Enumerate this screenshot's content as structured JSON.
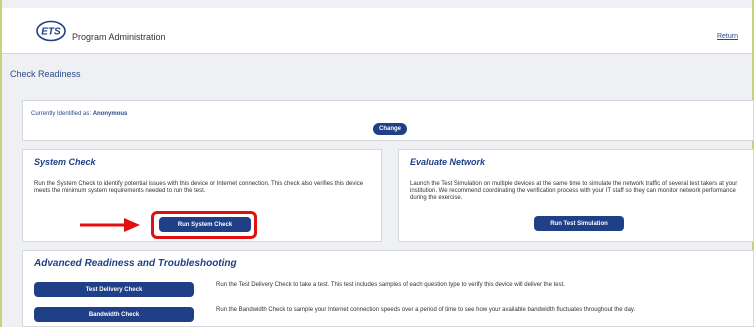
{
  "header": {
    "logo_text": "ETS",
    "title": "Program Administration",
    "return_label": "Return"
  },
  "page": {
    "title": "Check Readiness"
  },
  "identified": {
    "label": "Currently Identified as:",
    "value": "Anonymous",
    "change_label": "Change"
  },
  "system_check": {
    "heading": "System Check",
    "description": "Run the System Check to identify potential issues with this device or Internet connection. This check also verifies this device meets the minimum system requirements needed to run the test.",
    "button_label": "Run System Check"
  },
  "evaluate_network": {
    "heading": "Evaluate Network",
    "description": "Launch the Test Simulation on multiple devices at the same time to simulate the network traffic of several test takers at your institution. We recommend coordinating the verification process with your IT staff so they can monitor network performance during the exercise.",
    "button_label": "Run Test Simulation"
  },
  "advanced": {
    "heading": "Advanced Readiness and Troubleshooting",
    "items": [
      {
        "button_label": "Test Delivery Check",
        "description": "Run the Test Delivery Check to take a test. This test includes samples of each question type to verify this device will deliver the test."
      },
      {
        "button_label": "Bandwidth Check",
        "description": "Run the Bandwidth Check to sample your Internet connection speeds over a period of time to see how your available bandwidth fluctuates throughout the day."
      }
    ]
  },
  "colors": {
    "brand_blue": "#1f3f86",
    "highlight_red": "#e01010"
  }
}
